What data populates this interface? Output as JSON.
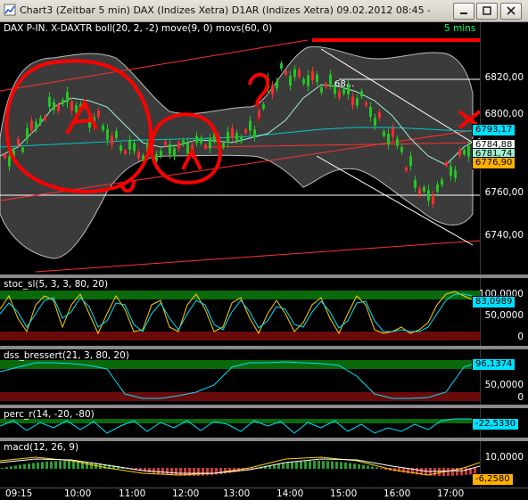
{
  "window": {
    "title": "Chart3 (Zeitbar 5 min)  DAX (Indizes Xetra) D1AR (Indizes Xetra) 09.02.2012 08:45 - 09.02...",
    "buttons": [
      "minimize",
      "maximize",
      "close"
    ]
  },
  "main_chart": {
    "label": "DAX P-IN. X-DAXTR boll(20, 2, -2) move(9, 0) movs(60, 0)",
    "interval": "5 mins",
    "y_ticks": [
      "6820,00",
      "6800,00",
      "6760,00",
      "6740,00"
    ],
    "price_tags": {
      "current": "6793,17",
      "a": "6784,88",
      "b": "6781,74",
      "c": "6776,90"
    },
    "annotation_text": "68...",
    "handwritten": [
      "A",
      "A",
      "?"
    ]
  },
  "stoc": {
    "label": "stoc_sl(5, 3, 3, 80, 20)",
    "y_ticks": [
      "100,0000",
      "50,0000",
      "0"
    ],
    "value": "83,0989"
  },
  "dss": {
    "label": "dss_bressert(21, 3, 80, 20)",
    "y_ticks": [
      "50,0000",
      "0"
    ],
    "value": "96,1374"
  },
  "perc": {
    "label": "perc_r(14, -20, -80)",
    "value": "-22,5330"
  },
  "macd": {
    "label": "macd(12, 26, 9)",
    "y_ticks": [
      "10,0000"
    ],
    "value": "-6,2580"
  },
  "time_axis": [
    "09:15",
    "10:00",
    "11:00",
    "12:00",
    "13:00",
    "14:00",
    "15:00",
    "16:00",
    "17:00"
  ],
  "colors": {
    "candle_up": "#22c522",
    "candle_down": "#ff2a2a",
    "bollinger": "#888888",
    "ma_fast": "#9ff0d0",
    "ma_slow": "#00c8c8",
    "trend_red": "#ff3030",
    "annotation_red": "#ff0000",
    "stoc_k": "#ffd000",
    "stoc_d": "#00e0ff",
    "dss": "#00e0ff",
    "zone_green": "#0a6a0a",
    "zone_red": "#6a0a0a",
    "value_tag": "#00e0ff",
    "tag_orange": "#ffb000"
  }
}
